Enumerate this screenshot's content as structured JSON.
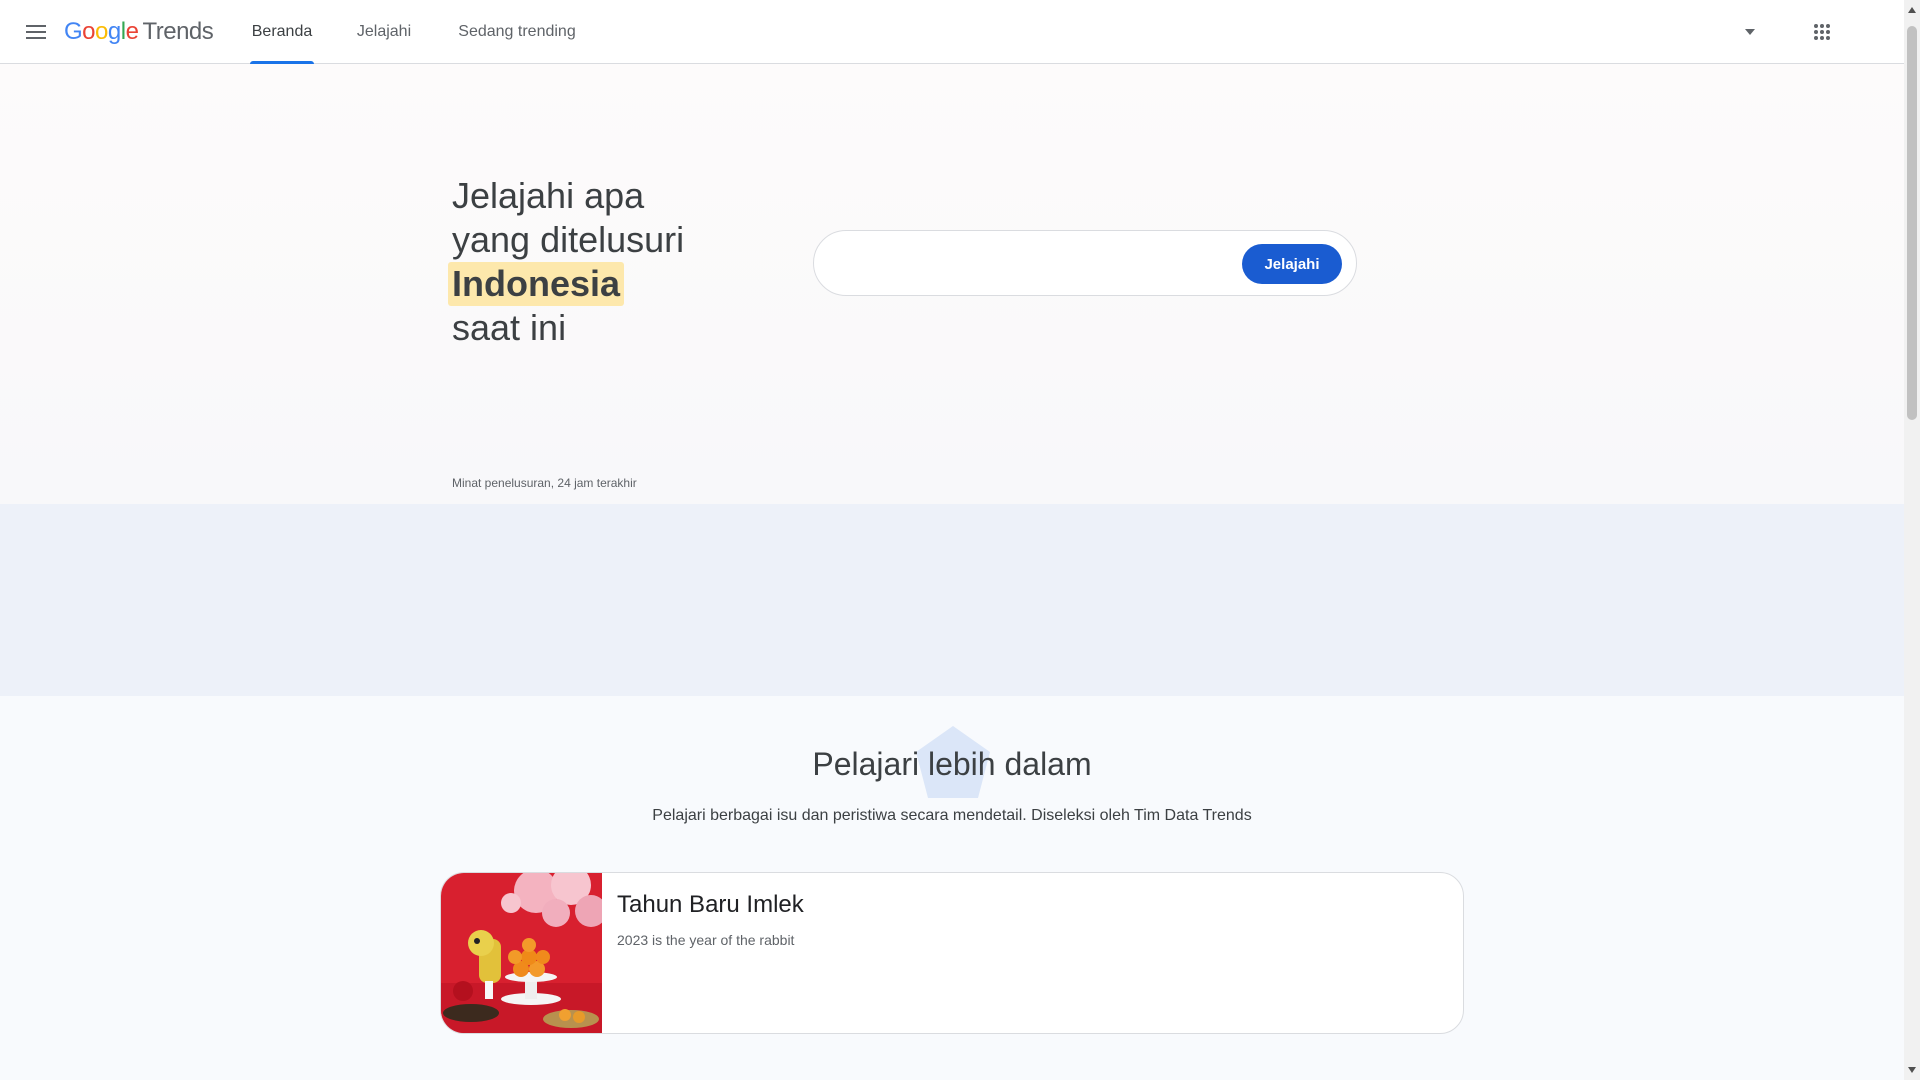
{
  "header": {
    "logo_letters": [
      "G",
      "o",
      "o",
      "g",
      "l",
      "e"
    ],
    "logo_product": "Trends",
    "tabs": [
      {
        "label": "Beranda",
        "active": true
      },
      {
        "label": "Jelajahi",
        "active": false
      },
      {
        "label": "Sedang trending",
        "active": false
      }
    ],
    "icons": {
      "menu": "menu-icon",
      "dropdown": "arrow-drop-down-icon",
      "apps": "apps-grid-icon"
    }
  },
  "hero": {
    "title_line1": "Jelajahi apa",
    "title_line2": "yang ditelusuri",
    "title_highlight": "Indonesia",
    "title_line4": "saat ini",
    "search_placeholder": "",
    "search_button": "Jelajahi",
    "interest_label": "Minat penelusuran, 24 jam terakhir"
  },
  "learn": {
    "title": "Pelajari lebih dalam",
    "subtitle": "Pelajari berbagai isu dan peristiwa secara mendetail. Diseleksi oleh Tim Data Trends",
    "stories": [
      {
        "title": "Tahun Baru Imlek",
        "subtitle": "2023 is the year of the rabbit"
      }
    ]
  },
  "colors": {
    "accent_blue": "#1a73e8",
    "button_blue": "#1a5cd1",
    "highlight_yellow": "#fde8ac",
    "band_blue": "#edf1f9"
  }
}
